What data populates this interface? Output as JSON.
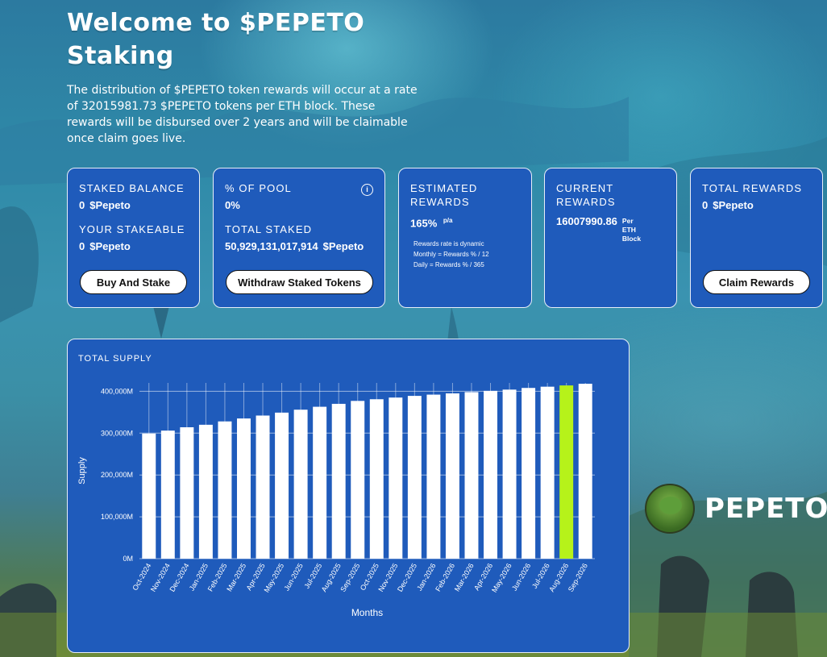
{
  "hero": {
    "title_line1": "Welcome to $PEPETO",
    "title_line2": "Staking",
    "description": "The distribution of $PEPETO token rewards will occur at a rate of 32015981.73 $PEPETO tokens per ETH block. These rewards will be disbursed over 2 years and will be claimable once claim goes live."
  },
  "cards": {
    "staked": {
      "staked_balance_label": "STAKED BALANCE",
      "staked_balance_value": "0",
      "staked_balance_unit": "$Pepeto",
      "stakeable_label": "YOUR STAKEABLE",
      "stakeable_value": "0",
      "stakeable_unit": "$Pepeto",
      "button": "Buy And Stake"
    },
    "pool": {
      "pool_label": "% OF POOL",
      "pool_value": "0%",
      "info_icon": "i",
      "total_staked_label": "TOTAL STAKED",
      "total_staked_value": "50,929,131,017,914",
      "total_staked_unit": "$Pepeto",
      "button": "Withdraw Staked Tokens"
    },
    "estimated": {
      "label_line1": "ESTIMATED",
      "label_line2": "REWARDS",
      "value": "165%",
      "suffix": "p/a",
      "note1": "Rewards rate is dynamic",
      "note2": "Monthly = Rewards % / 12",
      "note3": "Daily = Rewards % / 365"
    },
    "current": {
      "label_line1": "CURRENT",
      "label_line2": "REWARDS",
      "value": "16007990.86",
      "per1": "Per",
      "per2": "ETH",
      "per3": "Block"
    },
    "total": {
      "label": "TOTAL REWARDS",
      "value": "0",
      "unit": "$Pepeto",
      "button": "Claim Rewards"
    }
  },
  "brand": {
    "name": "PEPETO"
  },
  "colors": {
    "card": "#1f5bbb",
    "bar": "#ffffff",
    "highlight": "#b6f21a"
  },
  "chart_data": {
    "type": "bar",
    "title": "TOTAL SUPPLY",
    "xlabel": "Months",
    "ylabel": "Supply",
    "ylim": [
      0,
      420
    ],
    "yticks": [
      0,
      100,
      200,
      300,
      400
    ],
    "ytick_labels": [
      "0M",
      "100,000M",
      "200,000M",
      "300,000M",
      "400,000M"
    ],
    "unit": "billions of tokens (axis in M)",
    "categories": [
      "Oct-2024",
      "Nov-2024",
      "Dec-2024",
      "Jan-2025",
      "Feb-2025",
      "Mar-2025",
      "Apr-2025",
      "May-2025",
      "Jun-2025",
      "Jul-2025",
      "Aug-2025",
      "Sep-2025",
      "Oct-2025",
      "Nov-2025",
      "Dec-2025",
      "Jan-2026",
      "Feb-2026",
      "Mar-2026",
      "Apr-2026",
      "May-2026",
      "Jun-2026",
      "Jul-2026",
      "Aug-2026",
      "Sep-2026"
    ],
    "values": [
      299,
      306,
      314,
      320,
      328,
      335,
      342,
      349,
      356,
      363,
      370,
      377,
      381,
      385,
      389,
      392,
      395,
      398,
      401,
      404,
      408,
      411,
      414,
      418
    ],
    "highlight_index": 22,
    "grid": true
  }
}
